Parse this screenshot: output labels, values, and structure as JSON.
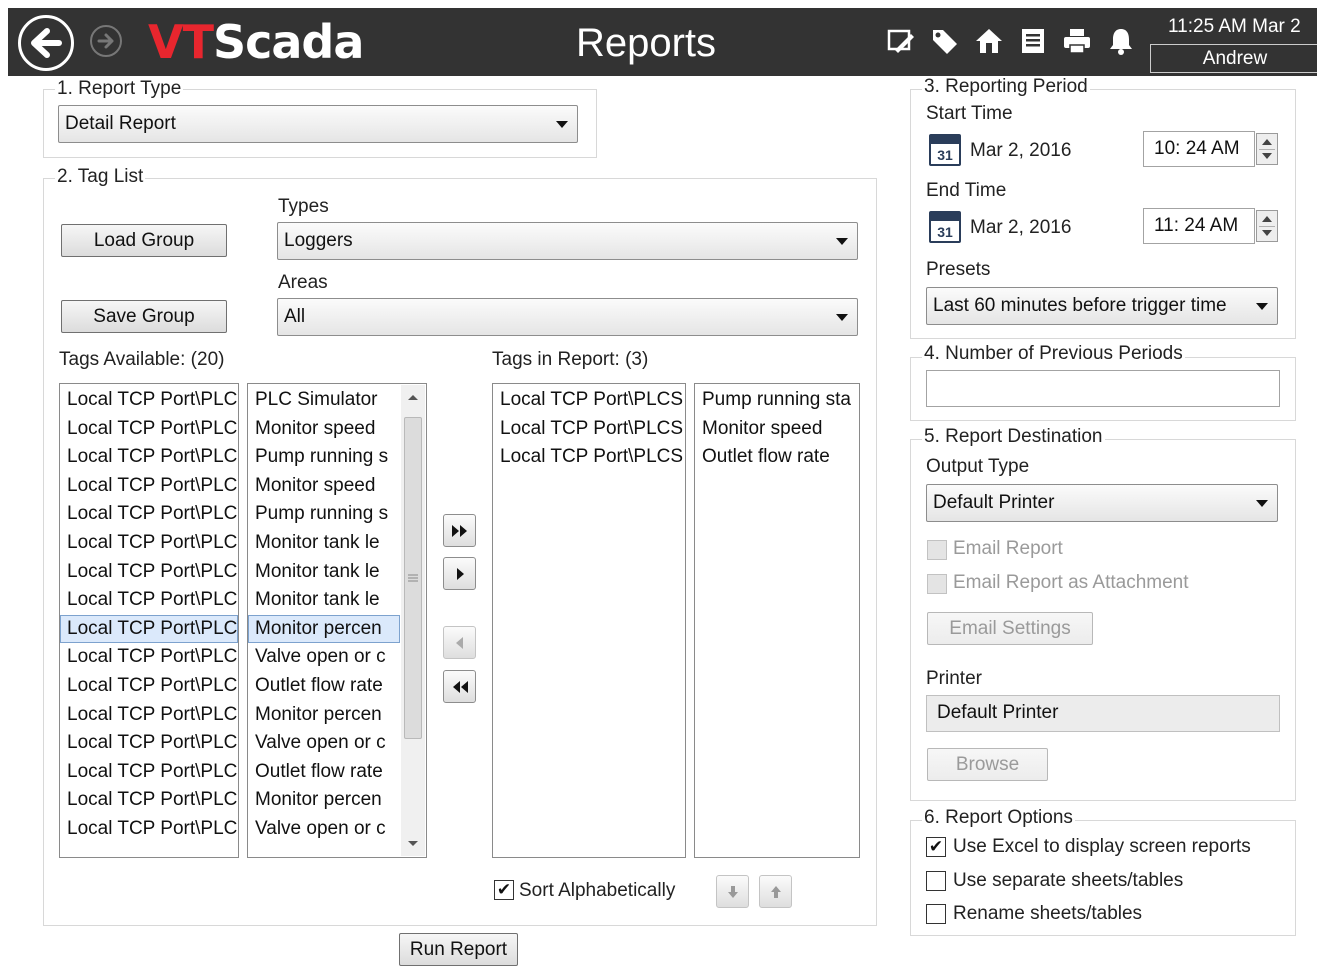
{
  "topbar": {
    "logo_vt": "VT",
    "logo_scada": "Scada",
    "title": "Reports",
    "clock": "11:25 AM  Mar 2",
    "user": "Andrew",
    "icons": [
      "edit-screen-icon",
      "tag-icon",
      "site-icon",
      "report-icon",
      "print-icon",
      "alarm-bell-icon"
    ]
  },
  "report_type": {
    "title": "1. Report Type",
    "selected": "Detail Report"
  },
  "tag_list": {
    "title": "2. Tag List",
    "load_group": "Load Group",
    "save_group": "Save Group",
    "types_label": "Types",
    "types_selected": "Loggers",
    "areas_label": "Areas",
    "areas_selected": "All",
    "available_label": "Tags Available: (20)",
    "in_report_label": "Tags in Report: (3)",
    "available_rows": [
      {
        "tag": "Local TCP Port\\PLC",
        "desc": "PLC Simulator"
      },
      {
        "tag": "Local TCP Port\\PLC",
        "desc": "Monitor speed"
      },
      {
        "tag": "Local TCP Port\\PLC",
        "desc": "Pump running s"
      },
      {
        "tag": "Local TCP Port\\PLC",
        "desc": "Monitor speed"
      },
      {
        "tag": "Local TCP Port\\PLC",
        "desc": "Pump running s"
      },
      {
        "tag": "Local TCP Port\\PLC",
        "desc": "Monitor tank le"
      },
      {
        "tag": "Local TCP Port\\PLC",
        "desc": "Monitor tank le"
      },
      {
        "tag": "Local TCP Port\\PLC",
        "desc": "Monitor tank le"
      },
      {
        "tag": "Local TCP Port\\PLC",
        "desc": "Monitor percen"
      },
      {
        "tag": "Local TCP Port\\PLC",
        "desc": "Valve open or c"
      },
      {
        "tag": "Local TCP Port\\PLC",
        "desc": "Outlet flow rate"
      },
      {
        "tag": "Local TCP Port\\PLC",
        "desc": "Monitor percen"
      },
      {
        "tag": "Local TCP Port\\PLC",
        "desc": "Valve open or c"
      },
      {
        "tag": "Local TCP Port\\PLC",
        "desc": "Outlet flow rate"
      },
      {
        "tag": "Local TCP Port\\PLC",
        "desc": "Monitor percen"
      },
      {
        "tag": "Local TCP Port\\PLC",
        "desc": "Valve open or c"
      }
    ],
    "selected_index": 8,
    "report_rows": [
      {
        "tag": "Local TCP Port\\PLCS",
        "desc": "Pump running sta"
      },
      {
        "tag": "Local TCP Port\\PLCS",
        "desc": "Monitor speed"
      },
      {
        "tag": "Local TCP Port\\PLCS",
        "desc": "Outlet flow rate"
      }
    ],
    "sort_label": "Sort Alphabetically",
    "sort_checked": "✔"
  },
  "run_report": "Run Report",
  "period": {
    "title": "3. Reporting Period",
    "start_label": "Start Time",
    "start_date": "Mar 2, 2016",
    "start_time": "10: 24 AM",
    "end_label": "End Time",
    "end_date": "Mar 2, 2016",
    "end_time": "11: 24 AM",
    "calendar_day": "31",
    "presets_label": "Presets",
    "presets_selected": "Last 60 minutes before trigger time"
  },
  "previous": {
    "title": "4. Number of Previous Periods",
    "value": ""
  },
  "destination": {
    "title": "5. Report Destination",
    "output_label": "Output Type",
    "output_selected": "Default Printer",
    "email_report": "Email Report",
    "email_attachment": "Email Report as Attachment",
    "email_settings": "Email Settings",
    "printer_label": "Printer",
    "printer_value": "Default Printer",
    "browse": "Browse"
  },
  "options": {
    "title": "6. Report Options",
    "use_excel": "Use Excel to display screen reports",
    "use_excel_checked": "✔",
    "separate_sheets": "Use separate sheets/tables",
    "rename_sheets": "Rename sheets/tables"
  }
}
